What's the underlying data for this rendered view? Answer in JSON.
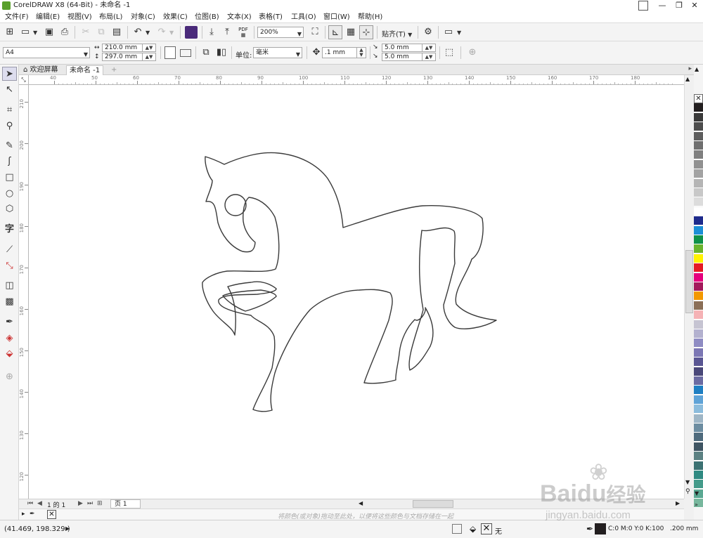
{
  "window": {
    "title": "CorelDRAW X8 (64-Bit) - 未命名 -1",
    "controls": {
      "minimize": "—",
      "restore": "❐",
      "close": "✕"
    }
  },
  "menu": [
    "文件(F)",
    "编辑(E)",
    "视图(V)",
    "布局(L)",
    "对象(C)",
    "效果(C)",
    "位图(B)",
    "文本(X)",
    "表格(T)",
    "工具(O)",
    "窗口(W)",
    "帮助(H)"
  ],
  "standard_toolbar": {
    "zoom_level": "200%",
    "snap_label": "贴齐(T)",
    "pdf_label": "PDF"
  },
  "property_bar": {
    "page_size": "A4",
    "width": "210.0 mm",
    "height": "297.0 mm",
    "units_label": "单位:",
    "units_value": "毫米",
    "nudge": ".1 mm",
    "dup_x": "5.0 mm",
    "dup_y": "5.0 mm"
  },
  "tabs": {
    "welcome": "欢迎屏幕",
    "document": "未命名 -1",
    "add": "+"
  },
  "rulers": {
    "horizontal": [
      "40",
      "50",
      "60",
      "70",
      "80",
      "90",
      "100",
      "110",
      "120",
      "130",
      "140",
      "150",
      "160",
      "170",
      "180"
    ],
    "vertical": [
      "210",
      "200",
      "190",
      "180",
      "170",
      "160",
      "150",
      "140",
      "130",
      "120"
    ],
    "unit": "毫米"
  },
  "page_nav": {
    "page_count": "1 的 1",
    "page_tab": "页 1"
  },
  "doc_palette_hint": "将颜色(或对象)拖动至此处，以便将这些颜色与文档存储在一起",
  "status": {
    "cursor_coords": "(41.469, 198.329 )",
    "fill_none": "无",
    "outline_cmyk": "C:0 M:0 Y:0 K:100",
    "outline_width": ".200 mm"
  },
  "palette_colors": [
    "#ffffff",
    "#231f20",
    "#3a3a3a",
    "#4d4d4d",
    "#5e5e5e",
    "#6f6f6f",
    "#808080",
    "#919191",
    "#a3a3a3",
    "#b5b5b5",
    "#c8c8c8",
    "#dcdcdc",
    "#ffffff",
    "#1e2b8c",
    "#1c8fd6",
    "#0f9148",
    "#6ab42d",
    "#fff200",
    "#e51a24",
    "#e5007d",
    "#a3195b",
    "#f39800",
    "#8b6f57",
    "#f5b2b5",
    "#c6c4d2",
    "#b3b1cf",
    "#8f8cc3",
    "#7c77b4",
    "#5a5693",
    "#4a4879",
    "#6b6ba2",
    "#1f7fc2",
    "#5fa3d7",
    "#8cbcdc",
    "#9fb6c6",
    "#6d8da1",
    "#4f6b7d",
    "#3f5563",
    "#5c8183",
    "#3c7273",
    "#2f8a82",
    "#449b8a",
    "#5aa892",
    "#77b79d"
  ],
  "watermark": {
    "brand": "Bai",
    "paw": "du",
    "chinese": "经验",
    "url": "jingyan.baidu.com"
  }
}
